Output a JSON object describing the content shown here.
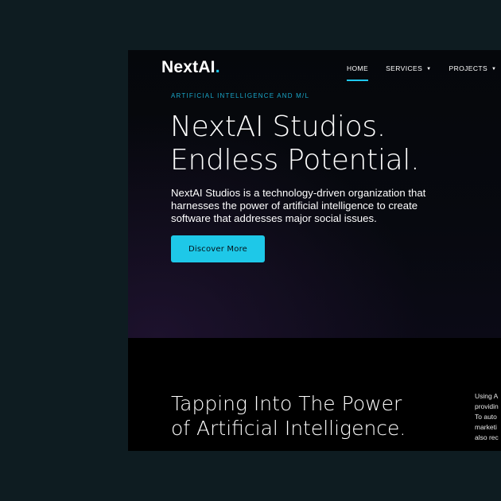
{
  "header": {
    "logo_text": "NextAI",
    "logo_dot": ".",
    "nav": [
      {
        "label": "HOME",
        "active": true
      },
      {
        "label": "SERVICES",
        "caret": "▼"
      },
      {
        "label": "PROJECTS",
        "caret": "▼"
      }
    ]
  },
  "hero": {
    "eyebrow": "ARTIFICIAL INTELLIGENCE AND M/L",
    "headline_line1": "NextAI Studios.",
    "headline_line2": "Endless Potential.",
    "intro": "NextAI Studios is a technology-driven organization that harnesses the power of artificial intelligence to create software that addresses major social issues.",
    "cta_label": "Discover More"
  },
  "section2": {
    "title_line1": "Tapping Into The Power",
    "title_line2": "of Artificial Intelligence.",
    "side_lines": [
      "Using A",
      "providin",
      "To auto",
      "marketi",
      "also rec"
    ]
  },
  "colors": {
    "accent": "#1ec8e8",
    "page_background": "#0e1c21",
    "site_background": "#05070b"
  }
}
